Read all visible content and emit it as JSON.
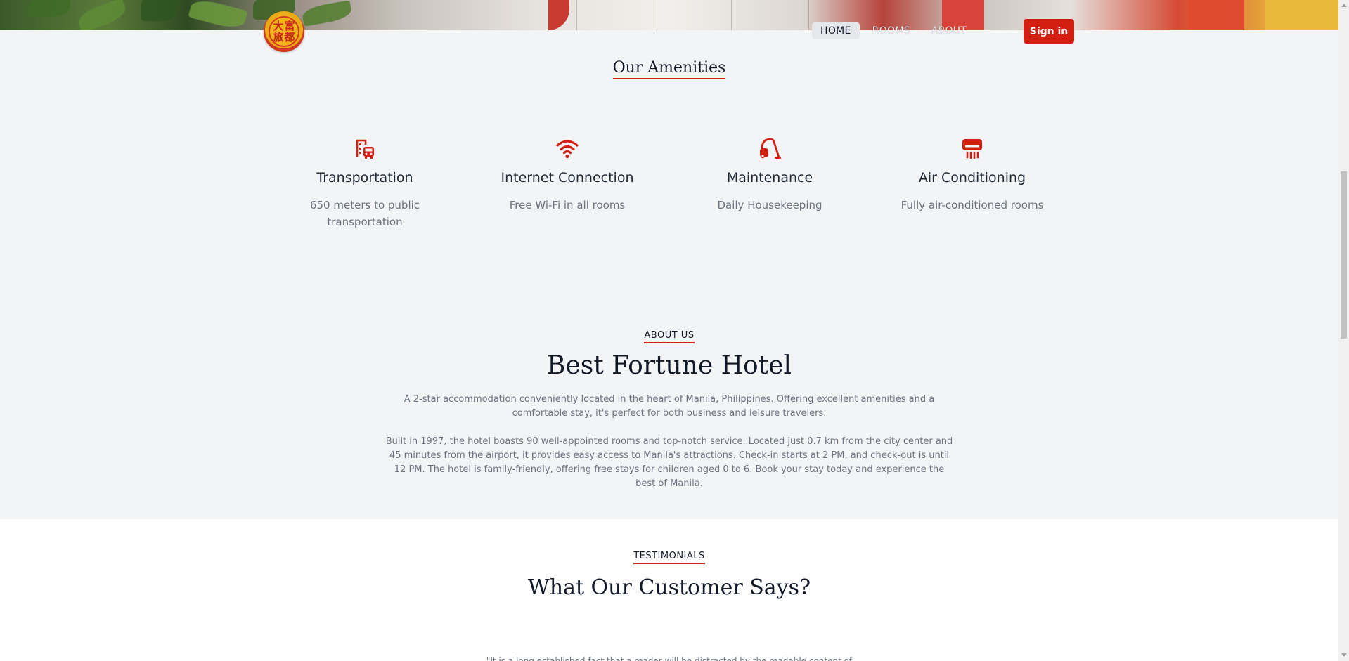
{
  "nav": {
    "logo_glyphs": [
      "大",
      "富",
      "旅",
      "都"
    ],
    "links": [
      "HOME",
      "ROOMS",
      "ABOUT"
    ],
    "sign_in": "Sign in"
  },
  "amenities": {
    "title": "Our Amenities",
    "items": [
      {
        "icon": "building-bus-icon",
        "title": "Transportation",
        "desc": "650 meters to public transportation"
      },
      {
        "icon": "wifi-icon",
        "title": "Internet Connection",
        "desc": "Free Wi-Fi in all rooms"
      },
      {
        "icon": "vacuum-cleaner-icon",
        "title": "Maintenance",
        "desc": "Daily Housekeeping"
      },
      {
        "icon": "air-conditioner-icon",
        "title": "Air Conditioning",
        "desc": "Fully air-conditioned rooms"
      }
    ]
  },
  "about": {
    "eyebrow": "ABOUT US",
    "title": "Best Fortune Hotel",
    "para1": "A 2-star accommodation conveniently located in the heart of Manila, Philippines. Offering excellent amenities and a comfortable stay, it's perfect for both business and leisure travelers.",
    "para2": "Built in 1997, the hotel boasts 90 well-appointed rooms and top-notch service. Located just 0.7 km from the city center and 45 minutes from the airport, it provides easy access to Manila's attractions. Check-in starts at 2 PM, and check-out is until 12 PM. The hotel is family-friendly, offering free stays for children aged 0 to 6. Book your stay today and experience the best of Manila."
  },
  "testimonials": {
    "eyebrow": "TESTIMONIALS",
    "title": "What Our Customer Says?",
    "quote": "\"It is a long established fact that a reader will be distracted by the readable content of"
  },
  "colors": {
    "accent": "#d21f12",
    "background": "#f3f4f6"
  }
}
